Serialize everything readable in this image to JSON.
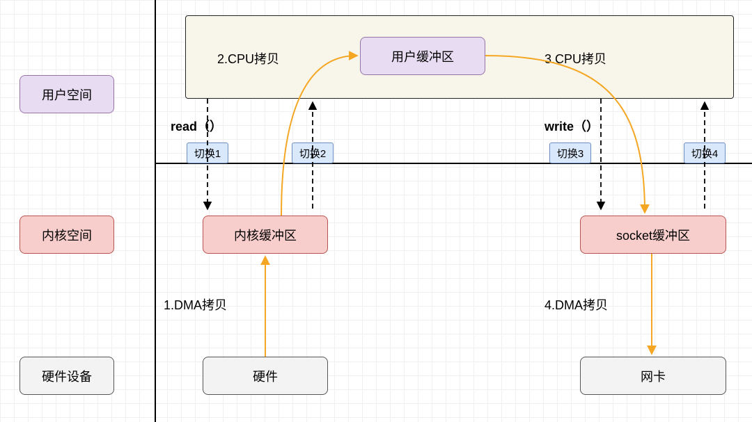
{
  "sidebar": {
    "user_space": "用户空间",
    "kernel_space": "内核空间",
    "hardware": "硬件设备"
  },
  "nodes": {
    "user_buffer": "用户缓冲区",
    "kernel_buffer": "内核缓冲区",
    "socket_buffer": "socket缓冲区",
    "hardware_block": "硬件",
    "nic": "网卡"
  },
  "labels": {
    "cpu_copy_2": "2.CPU拷贝",
    "cpu_copy_3": "3.CPU拷贝",
    "dma_copy_1": "1.DMA拷贝",
    "dma_copy_4": "4.DMA拷贝",
    "read": "read（）",
    "write": "write（）"
  },
  "switches": {
    "s1": "切换1",
    "s2": "切换2",
    "s3": "切换3",
    "s4": "切换4"
  },
  "colors": {
    "orange": "#f5a623",
    "purple_border": "#9673a6",
    "pink_border": "#b85450"
  }
}
